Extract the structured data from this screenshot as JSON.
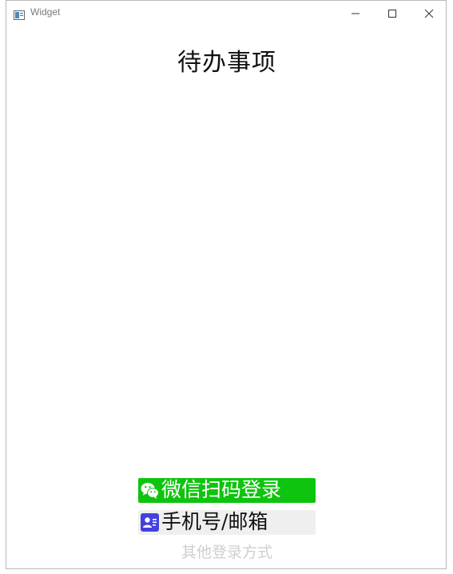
{
  "window": {
    "title": "Widget",
    "icons": {
      "app": "app-window-icon",
      "minimize": "minimize-icon",
      "maximize": "maximize-icon",
      "close": "close-icon"
    }
  },
  "main": {
    "title": "待办事项"
  },
  "login": {
    "wechat": {
      "label": "微信扫码登录",
      "icon": "wechat-icon",
      "color": "#0ec40e"
    },
    "phone": {
      "label": "手机号/邮箱",
      "icon": "contact-card-icon",
      "color": "#4340e0"
    },
    "other": "其他登录方式"
  }
}
